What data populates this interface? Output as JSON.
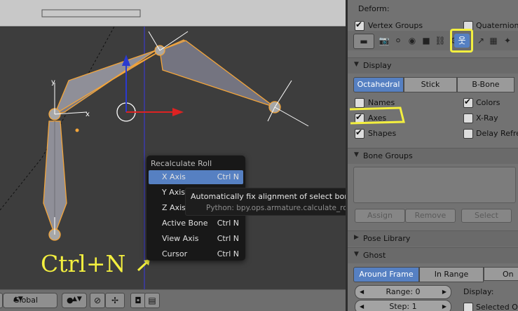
{
  "viewport": {
    "popup_menu": {
      "title": "Recalculate Roll",
      "items": [
        {
          "label": "X Axis",
          "shortcut": "Ctrl N",
          "active": true
        },
        {
          "label": "Y Axis",
          "shortcut": ""
        },
        {
          "label": "Z Axis",
          "shortcut": ""
        },
        {
          "label": "Active Bone",
          "shortcut": "Ctrl N"
        },
        {
          "label": "View Axis",
          "shortcut": "Ctrl N"
        },
        {
          "label": "Cursor",
          "shortcut": "Ctrl N"
        }
      ]
    },
    "tooltip": {
      "description": "Automatically fix alignment of select bones' axes",
      "python": "Python: bpy.ops.armature.calculate_roll()"
    },
    "annotation_text": "Ctrl+N",
    "axis_labels": {
      "y": "y",
      "x": "x"
    },
    "colors": {
      "bone_outline": "#f4a53a",
      "highlight": "#f3ef3f",
      "selection_blue": "#5680c2"
    }
  },
  "header": {
    "orientation": "Global"
  },
  "properties": {
    "deform_label": "Deform:",
    "vertex_groups": "Vertex Groups",
    "quaternion": "Quaternion",
    "display_section": "Display",
    "display_modes": [
      "Octahedral",
      "Stick",
      "B-Bone"
    ],
    "active_display_mode": "Octahedral",
    "names": "Names",
    "colors": "Colors",
    "axes": "Axes",
    "xray": "X-Ray",
    "shapes": "Shapes",
    "delay_refresh": "Delay Refresh",
    "bone_groups_section": "Bone Groups",
    "assign": "Assign",
    "remove": "Remove",
    "select": "Select",
    "pose_library_section": "Pose Library",
    "ghost_section": "Ghost",
    "ghost_modes": [
      "Around Frame",
      "In Range",
      "On Keyframes"
    ],
    "range_label": "Range: 0",
    "step_label": "Step: 1",
    "display_label": "Display:",
    "selected_only": "Selected Only"
  }
}
